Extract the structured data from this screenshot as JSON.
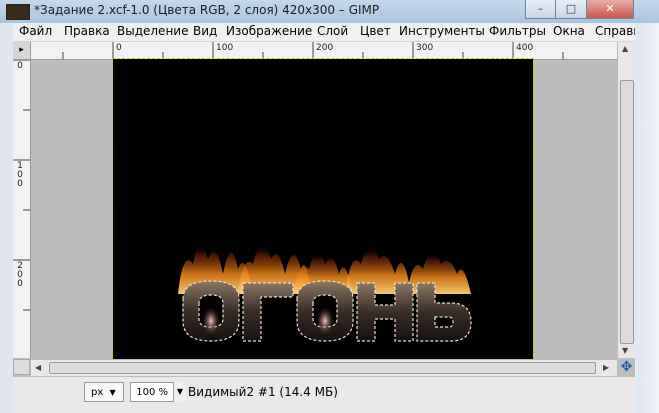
{
  "window": {
    "title": "*Задание 2.xcf-1.0 (Цвета RGB, 2 слоя) 420x300 – GIMP",
    "accent": "#b3cde6"
  },
  "menu": {
    "items": [
      "Файл",
      "Правка",
      "Выделение",
      "Вид",
      "Изображение",
      "Слой",
      "Цвет",
      "Инструменты",
      "Фильтры",
      "Окна",
      "Справка"
    ]
  },
  "ruler": {
    "h_labels": [
      "0",
      "100",
      "200",
      "300",
      "400"
    ],
    "v_labels": [
      "0",
      "100",
      "200"
    ]
  },
  "canvas": {
    "text": "ОГОНЬ",
    "background": "#000000",
    "selection_color": "#d8d800"
  },
  "status": {
    "unit": "px",
    "zoom": "100 %",
    "info": "Видимый2 #1 (14.4 МБ)"
  }
}
